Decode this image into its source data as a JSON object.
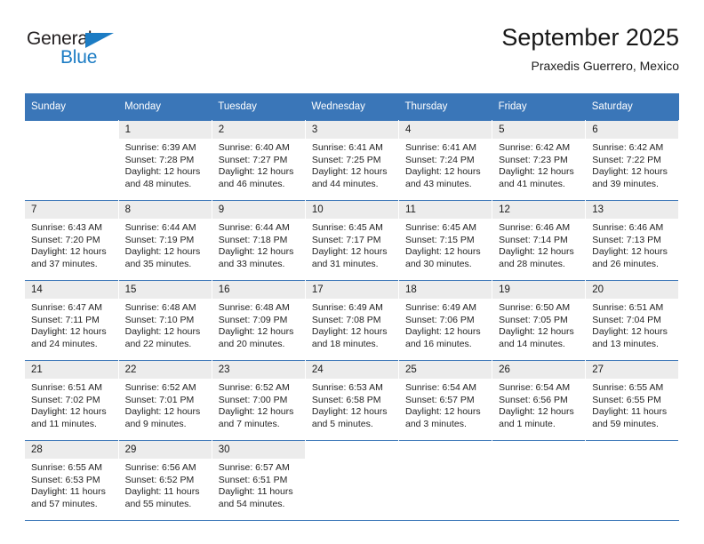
{
  "brand": {
    "name_top": "General",
    "name_bottom": "Blue",
    "triangle_color": "#1c7cc4",
    "text_color": "#231f20"
  },
  "header": {
    "title": "September 2025",
    "subtitle": "Praxedis Guerrero, Mexico"
  },
  "theme": {
    "header_blue": "#3a76b8",
    "daynum_band": "#ececec",
    "text": "#242424"
  },
  "weekdays": [
    "Sunday",
    "Monday",
    "Tuesday",
    "Wednesday",
    "Thursday",
    "Friday",
    "Saturday"
  ],
  "labels": {
    "sunrise_prefix": "Sunrise:",
    "sunset_prefix": "Sunset:",
    "daylight_prefix": "Daylight:"
  },
  "weeks": [
    [
      {
        "day": "",
        "sunrise": "",
        "sunset": "",
        "daylight": "",
        "blank": true
      },
      {
        "day": "1",
        "sunrise": "Sunrise: 6:39 AM",
        "sunset": "Sunset: 7:28 PM",
        "daylight": "Daylight: 12 hours and 48 minutes."
      },
      {
        "day": "2",
        "sunrise": "Sunrise: 6:40 AM",
        "sunset": "Sunset: 7:27 PM",
        "daylight": "Daylight: 12 hours and 46 minutes."
      },
      {
        "day": "3",
        "sunrise": "Sunrise: 6:41 AM",
        "sunset": "Sunset: 7:25 PM",
        "daylight": "Daylight: 12 hours and 44 minutes."
      },
      {
        "day": "4",
        "sunrise": "Sunrise: 6:41 AM",
        "sunset": "Sunset: 7:24 PM",
        "daylight": "Daylight: 12 hours and 43 minutes."
      },
      {
        "day": "5",
        "sunrise": "Sunrise: 6:42 AM",
        "sunset": "Sunset: 7:23 PM",
        "daylight": "Daylight: 12 hours and 41 minutes."
      },
      {
        "day": "6",
        "sunrise": "Sunrise: 6:42 AM",
        "sunset": "Sunset: 7:22 PM",
        "daylight": "Daylight: 12 hours and 39 minutes."
      }
    ],
    [
      {
        "day": "7",
        "sunrise": "Sunrise: 6:43 AM",
        "sunset": "Sunset: 7:20 PM",
        "daylight": "Daylight: 12 hours and 37 minutes."
      },
      {
        "day": "8",
        "sunrise": "Sunrise: 6:44 AM",
        "sunset": "Sunset: 7:19 PM",
        "daylight": "Daylight: 12 hours and 35 minutes."
      },
      {
        "day": "9",
        "sunrise": "Sunrise: 6:44 AM",
        "sunset": "Sunset: 7:18 PM",
        "daylight": "Daylight: 12 hours and 33 minutes."
      },
      {
        "day": "10",
        "sunrise": "Sunrise: 6:45 AM",
        "sunset": "Sunset: 7:17 PM",
        "daylight": "Daylight: 12 hours and 31 minutes."
      },
      {
        "day": "11",
        "sunrise": "Sunrise: 6:45 AM",
        "sunset": "Sunset: 7:15 PM",
        "daylight": "Daylight: 12 hours and 30 minutes."
      },
      {
        "day": "12",
        "sunrise": "Sunrise: 6:46 AM",
        "sunset": "Sunset: 7:14 PM",
        "daylight": "Daylight: 12 hours and 28 minutes."
      },
      {
        "day": "13",
        "sunrise": "Sunrise: 6:46 AM",
        "sunset": "Sunset: 7:13 PM",
        "daylight": "Daylight: 12 hours and 26 minutes."
      }
    ],
    [
      {
        "day": "14",
        "sunrise": "Sunrise: 6:47 AM",
        "sunset": "Sunset: 7:11 PM",
        "daylight": "Daylight: 12 hours and 24 minutes."
      },
      {
        "day": "15",
        "sunrise": "Sunrise: 6:48 AM",
        "sunset": "Sunset: 7:10 PM",
        "daylight": "Daylight: 12 hours and 22 minutes."
      },
      {
        "day": "16",
        "sunrise": "Sunrise: 6:48 AM",
        "sunset": "Sunset: 7:09 PM",
        "daylight": "Daylight: 12 hours and 20 minutes."
      },
      {
        "day": "17",
        "sunrise": "Sunrise: 6:49 AM",
        "sunset": "Sunset: 7:08 PM",
        "daylight": "Daylight: 12 hours and 18 minutes."
      },
      {
        "day": "18",
        "sunrise": "Sunrise: 6:49 AM",
        "sunset": "Sunset: 7:06 PM",
        "daylight": "Daylight: 12 hours and 16 minutes."
      },
      {
        "day": "19",
        "sunrise": "Sunrise: 6:50 AM",
        "sunset": "Sunset: 7:05 PM",
        "daylight": "Daylight: 12 hours and 14 minutes."
      },
      {
        "day": "20",
        "sunrise": "Sunrise: 6:51 AM",
        "sunset": "Sunset: 7:04 PM",
        "daylight": "Daylight: 12 hours and 13 minutes."
      }
    ],
    [
      {
        "day": "21",
        "sunrise": "Sunrise: 6:51 AM",
        "sunset": "Sunset: 7:02 PM",
        "daylight": "Daylight: 12 hours and 11 minutes."
      },
      {
        "day": "22",
        "sunrise": "Sunrise: 6:52 AM",
        "sunset": "Sunset: 7:01 PM",
        "daylight": "Daylight: 12 hours and 9 minutes."
      },
      {
        "day": "23",
        "sunrise": "Sunrise: 6:52 AM",
        "sunset": "Sunset: 7:00 PM",
        "daylight": "Daylight: 12 hours and 7 minutes."
      },
      {
        "day": "24",
        "sunrise": "Sunrise: 6:53 AM",
        "sunset": "Sunset: 6:58 PM",
        "daylight": "Daylight: 12 hours and 5 minutes."
      },
      {
        "day": "25",
        "sunrise": "Sunrise: 6:54 AM",
        "sunset": "Sunset: 6:57 PM",
        "daylight": "Daylight: 12 hours and 3 minutes."
      },
      {
        "day": "26",
        "sunrise": "Sunrise: 6:54 AM",
        "sunset": "Sunset: 6:56 PM",
        "daylight": "Daylight: 12 hours and 1 minute."
      },
      {
        "day": "27",
        "sunrise": "Sunrise: 6:55 AM",
        "sunset": "Sunset: 6:55 PM",
        "daylight": "Daylight: 11 hours and 59 minutes."
      }
    ],
    [
      {
        "day": "28",
        "sunrise": "Sunrise: 6:55 AM",
        "sunset": "Sunset: 6:53 PM",
        "daylight": "Daylight: 11 hours and 57 minutes."
      },
      {
        "day": "29",
        "sunrise": "Sunrise: 6:56 AM",
        "sunset": "Sunset: 6:52 PM",
        "daylight": "Daylight: 11 hours and 55 minutes."
      },
      {
        "day": "30",
        "sunrise": "Sunrise: 6:57 AM",
        "sunset": "Sunset: 6:51 PM",
        "daylight": "Daylight: 11 hours and 54 minutes."
      },
      {
        "day": "",
        "sunrise": "",
        "sunset": "",
        "daylight": "",
        "blank": true
      },
      {
        "day": "",
        "sunrise": "",
        "sunset": "",
        "daylight": "",
        "blank": true
      },
      {
        "day": "",
        "sunrise": "",
        "sunset": "",
        "daylight": "",
        "blank": true
      },
      {
        "day": "",
        "sunrise": "",
        "sunset": "",
        "daylight": "",
        "blank": true
      }
    ]
  ]
}
